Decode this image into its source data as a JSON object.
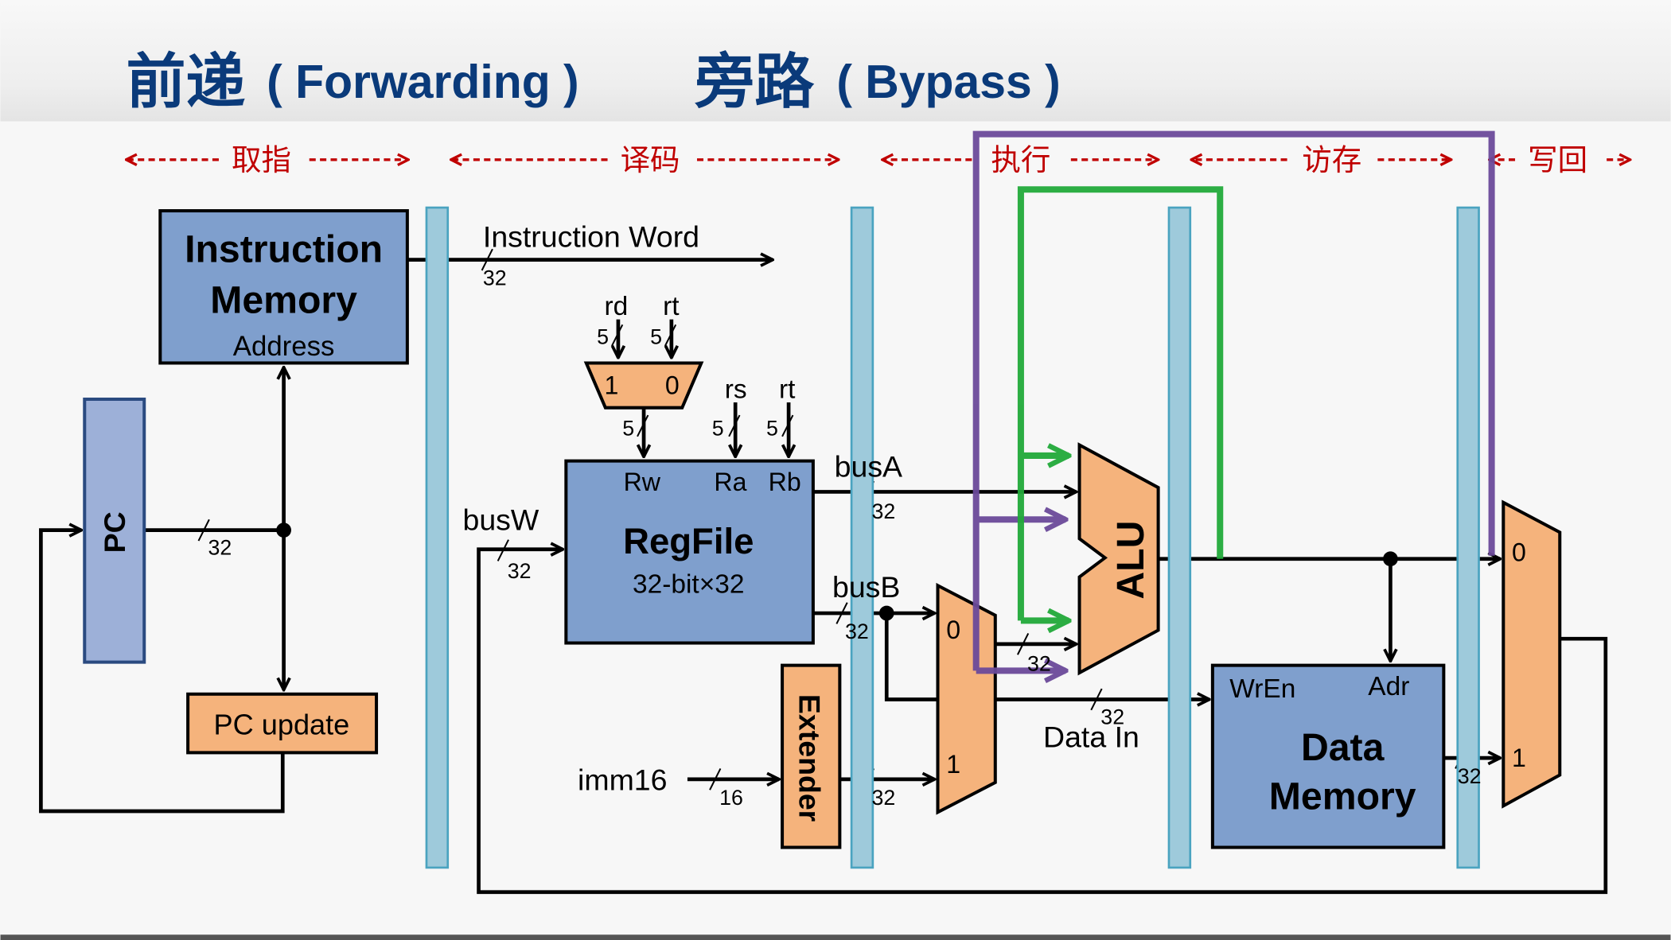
{
  "title": {
    "part1_cn": "前递",
    "part1_en": "( Forwarding )",
    "part2_cn": "旁路",
    "part2_en": "( Bypass )"
  },
  "stages": [
    "取指",
    "译码",
    "执行",
    "访存",
    "写回"
  ],
  "blocks": {
    "imem_line1": "Instruction",
    "imem_line2": "Memory",
    "imem_address": "Address",
    "pc": "PC",
    "pc_update": "PC update",
    "regfile": "RegFile",
    "regfile_size": "32-bit×32",
    "rw": "Rw",
    "ra": "Ra",
    "rb": "Rb",
    "extender": "Extender",
    "alu": "ALU",
    "dmem_line1": "Data",
    "dmem_line2": "Memory",
    "wren": "WrEn",
    "adr": "Adr"
  },
  "signals": {
    "instruction_word": "Instruction Word",
    "rd": "rd",
    "rt": "rt",
    "rs": "rs",
    "busA": "busA",
    "busB": "busB",
    "busW": "busW",
    "imm16": "imm16",
    "data_in": "Data In",
    "w32": "32",
    "w5": "5",
    "w16": "16",
    "mux_0": "0",
    "mux_1": "1"
  },
  "colors": {
    "title": "#0a3a7a",
    "stage_label": "#c00000",
    "memory_block": "#7f9fcd",
    "orange_block": "#f5b37c",
    "pipeline_register": "#9ecadb",
    "forward_path_mem": "#6b4a9a",
    "forward_path_ex": "#22aa3a"
  }
}
